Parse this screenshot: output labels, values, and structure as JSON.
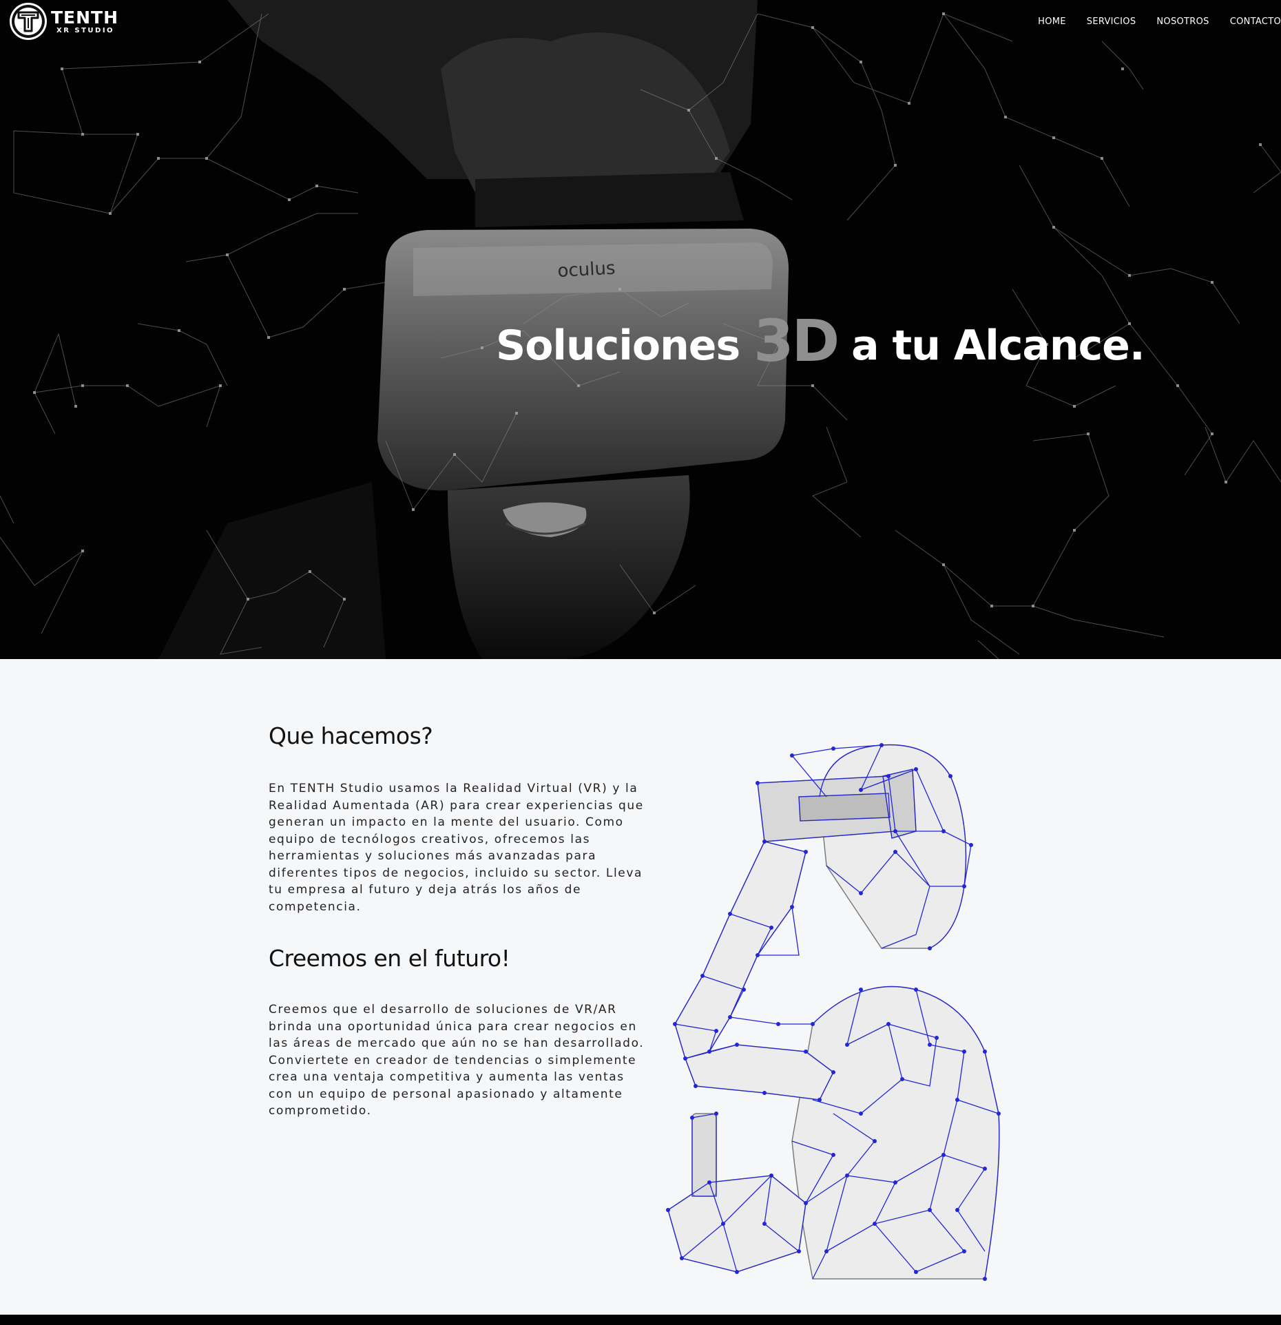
{
  "brand": {
    "name": "TENTH",
    "subtitle": "XR STUDIO"
  },
  "nav": {
    "items": [
      {
        "label": "HOME"
      },
      {
        "label": "SERVICIOS"
      },
      {
        "label": "NOSOTROS"
      },
      {
        "label": "CONTACTO"
      }
    ]
  },
  "hero": {
    "title_before": "Soluciones ",
    "title_accent": "3D",
    "title_after": " a tu Alcance."
  },
  "sections": [
    {
      "heading": "Que hacemos?",
      "body": "En TENTH Studio usamos la Realidad Virtual (VR) y la Realidad Aumentada (AR) para crear experiencias que generan un impacto en la mente del usuario. Como equipo de tecnólogos creativos, ofrecemos las herramientas y soluciones más avanzadas para diferentes tipos de negocios, incluido su sector. Lleva tu empresa al futuro y deja atrás los años de competencia."
    },
    {
      "heading": "Creemos en el futuro!",
      "body": "Creemos que el desarrollo de soluciones de VR/AR brinda una oportunidad única para crear negocios en las áreas de mercado que aún no se han desarrollado. Conviertete en creador de tendencias o simplemente crea una ventaja competitiva y aumenta las ventas con un equipo de personal apasionado y altamente comprometido."
    }
  ],
  "hero_photo": {
    "headset_brand": "oculus"
  },
  "colors": {
    "hero_bg": "#020202",
    "content_bg": "#f6f7f9",
    "mesh_accent": "#2226d6",
    "text_dark": "#111111"
  }
}
